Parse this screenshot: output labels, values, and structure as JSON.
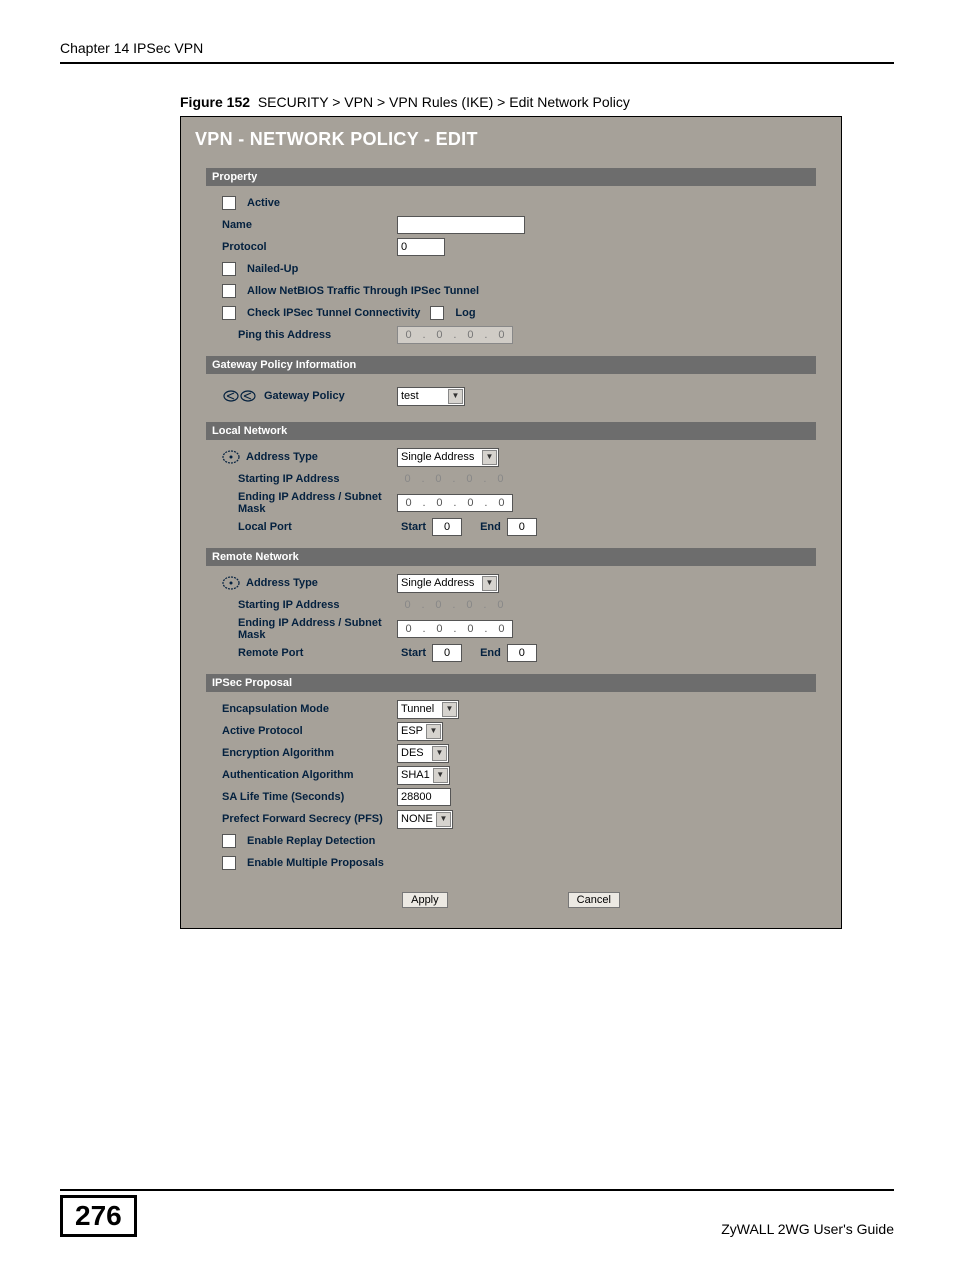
{
  "page": {
    "chapter_header": "Chapter 14 IPSec VPN",
    "figure_label": "Figure 152",
    "figure_breadcrumb": "SECURITY > VPN > VPN Rules (IKE) > Edit Network Policy",
    "page_number": "276",
    "footer_text": "ZyWALL 2WG User's Guide"
  },
  "panel": {
    "title": "VPN - NETWORK POLICY - EDIT",
    "apply": "Apply",
    "cancel": "Cancel"
  },
  "property": {
    "header": "Property",
    "active": "Active",
    "name": "Name",
    "name_value": "",
    "protocol": "Protocol",
    "protocol_value": "0",
    "nailed_up": "Nailed-Up",
    "netbios": "Allow NetBIOS Traffic Through IPSec Tunnel",
    "check_conn": "Check IPSec Tunnel Connectivity",
    "log": "Log",
    "ping_addr": "Ping this Address",
    "ping_ip": [
      "0",
      "0",
      "0",
      "0"
    ]
  },
  "gateway": {
    "header": "Gateway Policy Information",
    "label": "Gateway Policy",
    "value": "test"
  },
  "local": {
    "header": "Local Network",
    "addr_type": "Address Type",
    "addr_type_value": "Single Address",
    "start_ip": "Starting IP Address",
    "start_ip_val": [
      "0",
      "0",
      "0",
      "0"
    ],
    "end_ip": "Ending IP Address / Subnet Mask",
    "end_ip_val": [
      "0",
      "0",
      "0",
      "0"
    ],
    "port": "Local Port",
    "port_start_label": "Start",
    "port_start_val": "0",
    "port_end_label": "End",
    "port_end_val": "0"
  },
  "remote": {
    "header": "Remote Network",
    "addr_type": "Address Type",
    "addr_type_value": "Single Address",
    "start_ip": "Starting IP Address",
    "start_ip_val": [
      "0",
      "0",
      "0",
      "0"
    ],
    "end_ip": "Ending IP Address / Subnet Mask",
    "end_ip_val": [
      "0",
      "0",
      "0",
      "0"
    ],
    "port": "Remote Port",
    "port_start_label": "Start",
    "port_start_val": "0",
    "port_end_label": "End",
    "port_end_val": "0"
  },
  "ipsec": {
    "header": "IPSec Proposal",
    "encap": "Encapsulation Mode",
    "encap_value": "Tunnel",
    "active_proto": "Active Protocol",
    "active_proto_value": "ESP",
    "enc_algo": "Encryption Algorithm",
    "enc_algo_value": "DES",
    "auth_algo": "Authentication Algorithm",
    "auth_algo_value": "SHA1",
    "sa_life": "SA Life Time (Seconds)",
    "sa_life_value": "28800",
    "pfs": "Prefect Forward Secrecy (PFS)",
    "pfs_value": "NONE",
    "replay": "Enable Replay Detection",
    "multi_prop": "Enable Multiple Proposals"
  }
}
